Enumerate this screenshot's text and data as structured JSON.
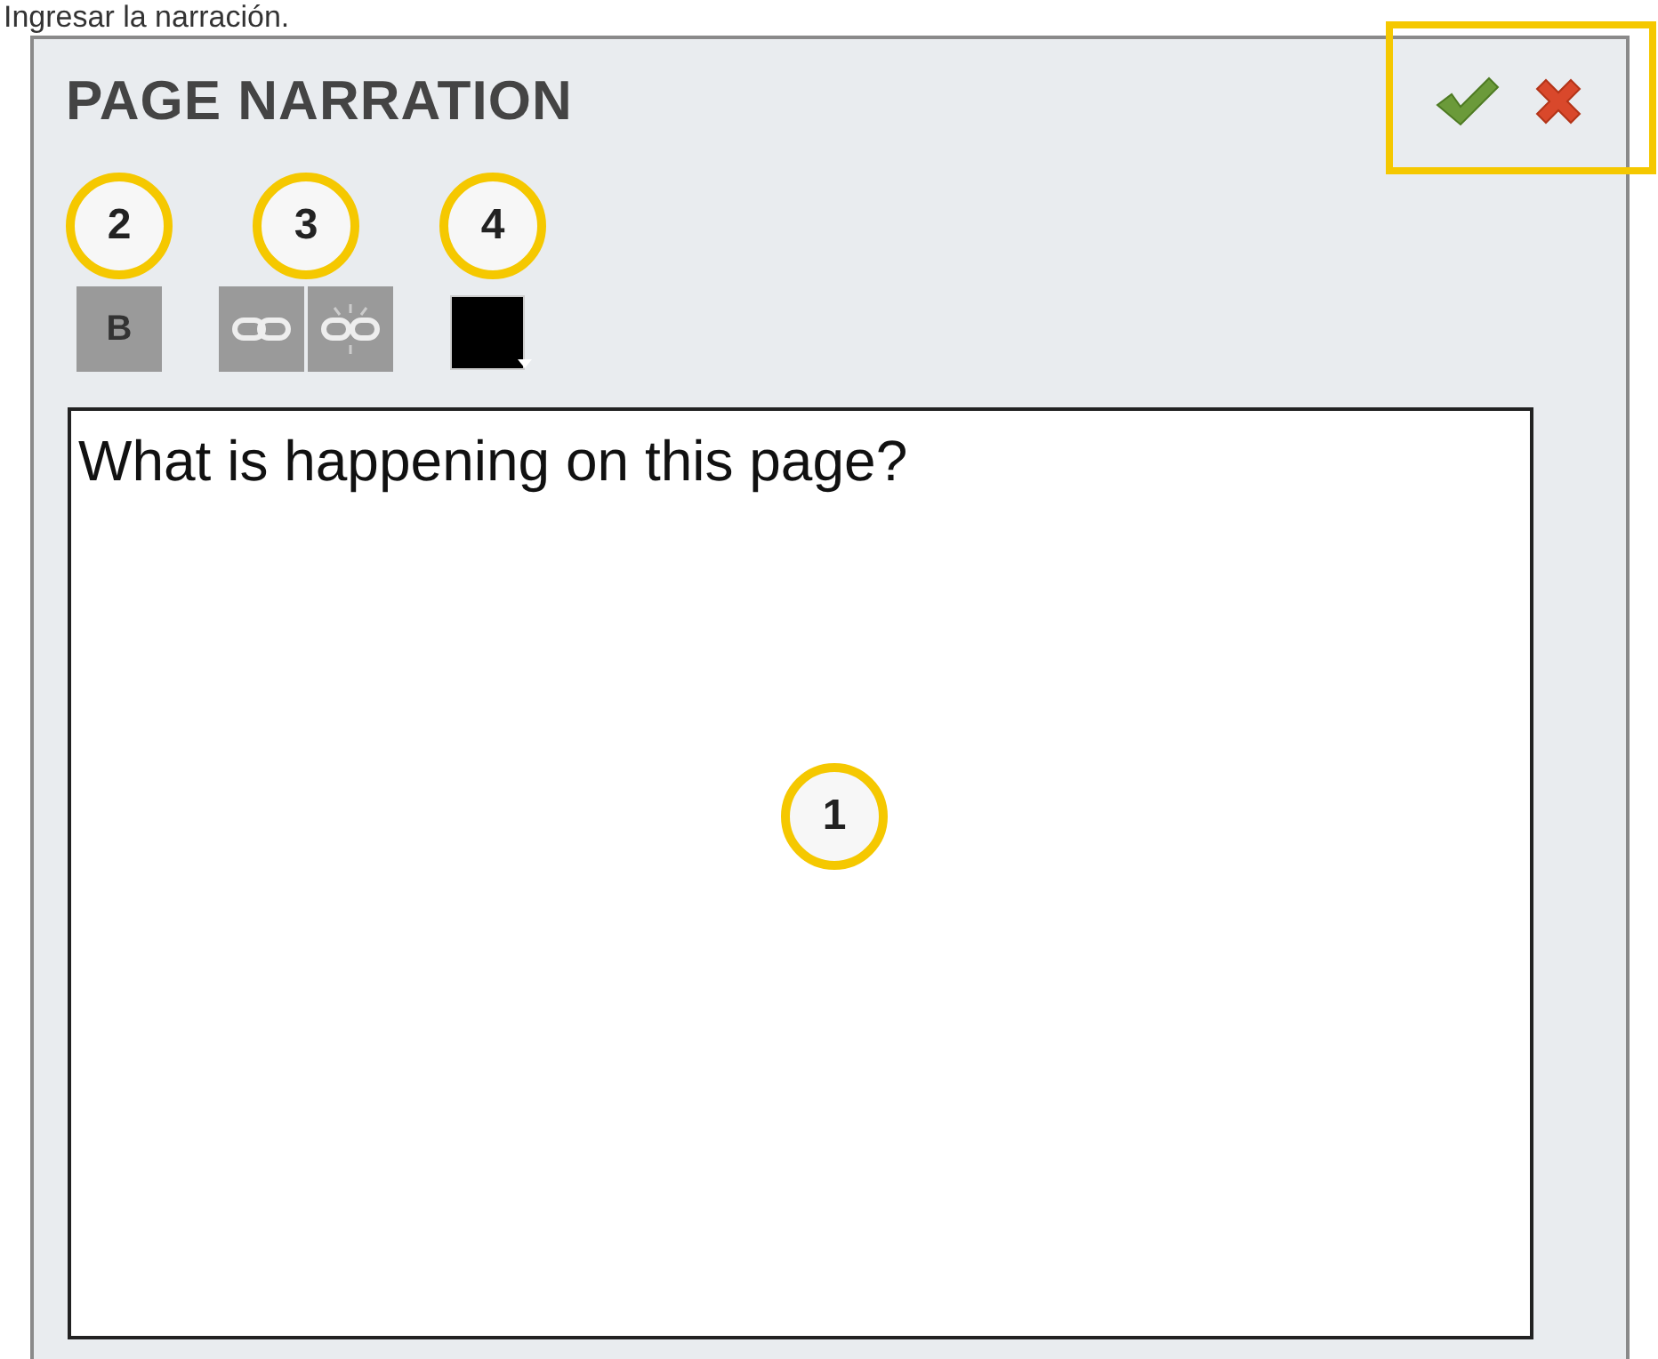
{
  "caption": "Ingresar la narración.",
  "panel": {
    "title": "PAGE NARRATION",
    "actions": [
      {
        "kind": "confirm"
      },
      {
        "kind": "cancel"
      }
    ],
    "actions_highlighted": true,
    "toolbar_groups": [
      {
        "callout": "2",
        "tools": [
          {
            "kind": "bold",
            "label": "B"
          }
        ]
      },
      {
        "callout": "3",
        "tools": [
          {
            "kind": "link"
          },
          {
            "kind": "unlink"
          }
        ]
      },
      {
        "callout": "4",
        "tools": [
          {
            "kind": "color",
            "color": "#000000"
          }
        ]
      }
    ],
    "narration": {
      "value": "What is happening on this page?",
      "callout": "1"
    }
  }
}
